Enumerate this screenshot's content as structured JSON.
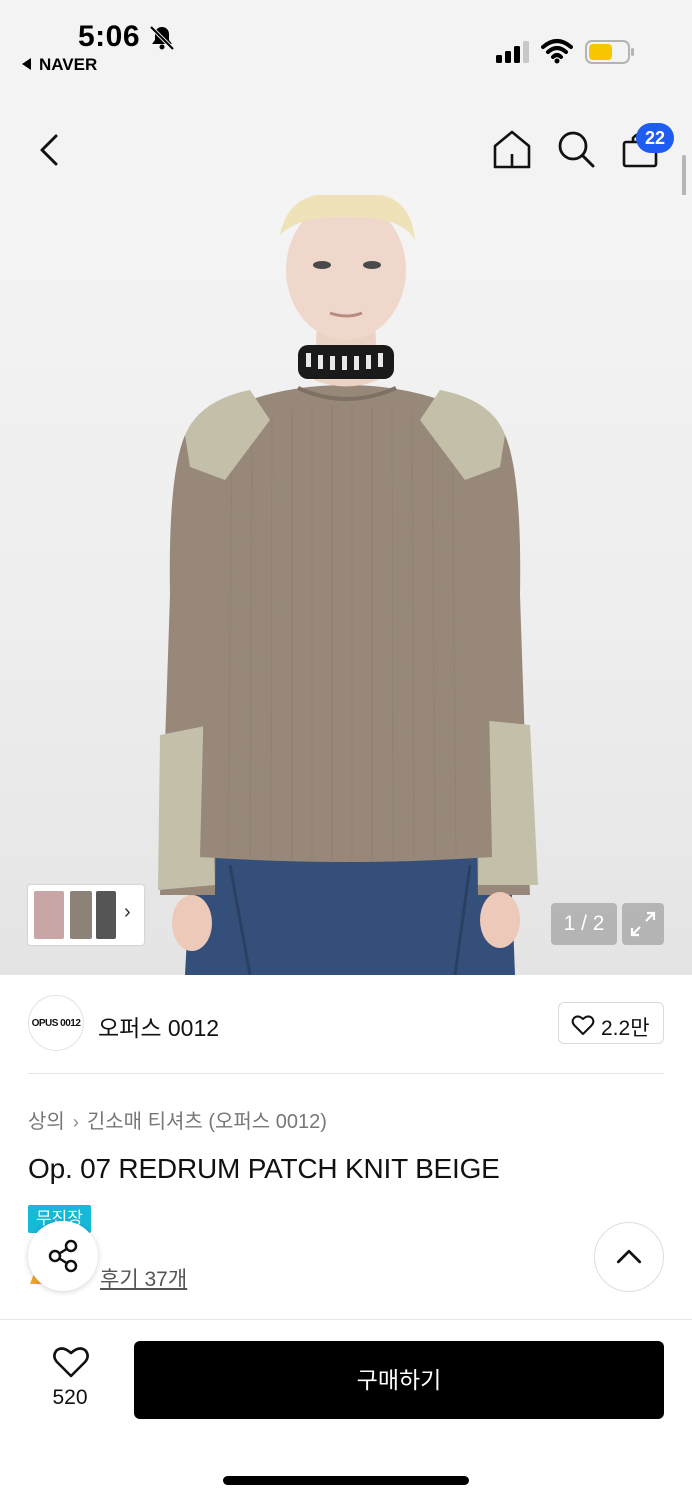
{
  "status_bar": {
    "time": "5:06",
    "back_app": "NAVER"
  },
  "nav": {
    "cart_count": "22"
  },
  "gallery": {
    "counter": "1 / 2"
  },
  "brand": {
    "logo_text": "OPUS 0012",
    "name": "오퍼스 0012",
    "likes": "2.2만"
  },
  "product": {
    "breadcrumb": [
      "상의",
      "긴소매 티셔츠 (오퍼스 0012)"
    ],
    "title": "Op. 07 REDRUM PATCH KNIT BEIGE",
    "tag": "무진장",
    "review_link": "후기 37개"
  },
  "bottom_bar": {
    "wish_count": "520",
    "buy_label": "구매하기"
  },
  "colors": {
    "accent_blue": "#1f5cf1",
    "tag_cyan": "#17b8d8",
    "buy_button": "#000000",
    "sweater": "#97887a",
    "patch": "#c3bfa9"
  }
}
